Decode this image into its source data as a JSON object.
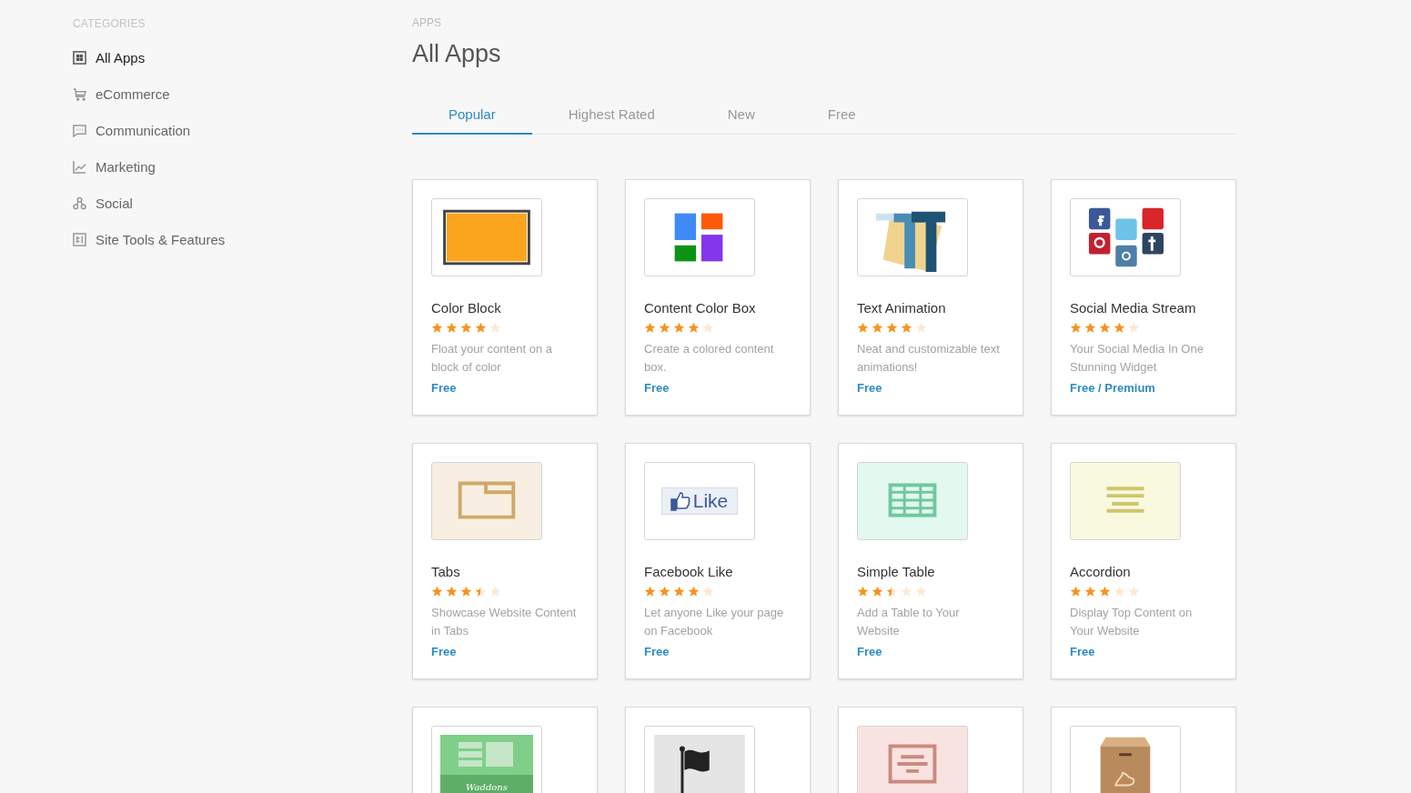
{
  "sidebar": {
    "heading": "CATEGORIES",
    "items": [
      {
        "label": "All Apps",
        "selected": true
      },
      {
        "label": "eCommerce",
        "selected": false
      },
      {
        "label": "Communication",
        "selected": false
      },
      {
        "label": "Marketing",
        "selected": false
      },
      {
        "label": "Social",
        "selected": false
      },
      {
        "label": "Site Tools & Features",
        "selected": false
      }
    ]
  },
  "header": {
    "breadcrumb": "APPS",
    "title": "All Apps"
  },
  "tabs": [
    {
      "label": "Popular",
      "selected": true
    },
    {
      "label": "Highest Rated",
      "selected": false
    },
    {
      "label": "New",
      "selected": false
    },
    {
      "label": "Free",
      "selected": false
    }
  ],
  "apps": [
    {
      "kind": "color-block",
      "name": "Color Block",
      "stars": 4,
      "description": "Float your content on a block of color",
      "price": "Free"
    },
    {
      "kind": "color-box",
      "name": "Content Color Box",
      "stars": 4,
      "description": "Create a colored content box.",
      "price": "Free"
    },
    {
      "kind": "text-animation",
      "name": "Text Animation",
      "stars": 4,
      "description": "Neat and customizable text animations!",
      "price": "Free"
    },
    {
      "kind": "social",
      "name": "Social Media Stream",
      "stars": 4,
      "description": "Your Social Media In One Stunning Widget",
      "price": "Free / Premium"
    },
    {
      "kind": "tabs",
      "name": "Tabs",
      "stars": 3.5,
      "description": "Showcase Website Content in Tabs",
      "price": "Free"
    },
    {
      "kind": "like",
      "name": "Facebook Like",
      "stars": 4,
      "description": "Let anyone Like your page on Facebook",
      "price": "Free",
      "thumb_text": "Like"
    },
    {
      "kind": "table",
      "name": "Simple Table",
      "stars": 2.5,
      "description": "Add a Table to Your Website",
      "price": "Free"
    },
    {
      "kind": "accordion",
      "name": "Accordion",
      "stars": 3,
      "description": "Display Top Content on Your Website",
      "price": "Free"
    },
    {
      "kind": "addons",
      "thumb_text": "Waddons"
    },
    {
      "kind": "flag"
    },
    {
      "kind": "form"
    },
    {
      "kind": "box"
    }
  ]
}
